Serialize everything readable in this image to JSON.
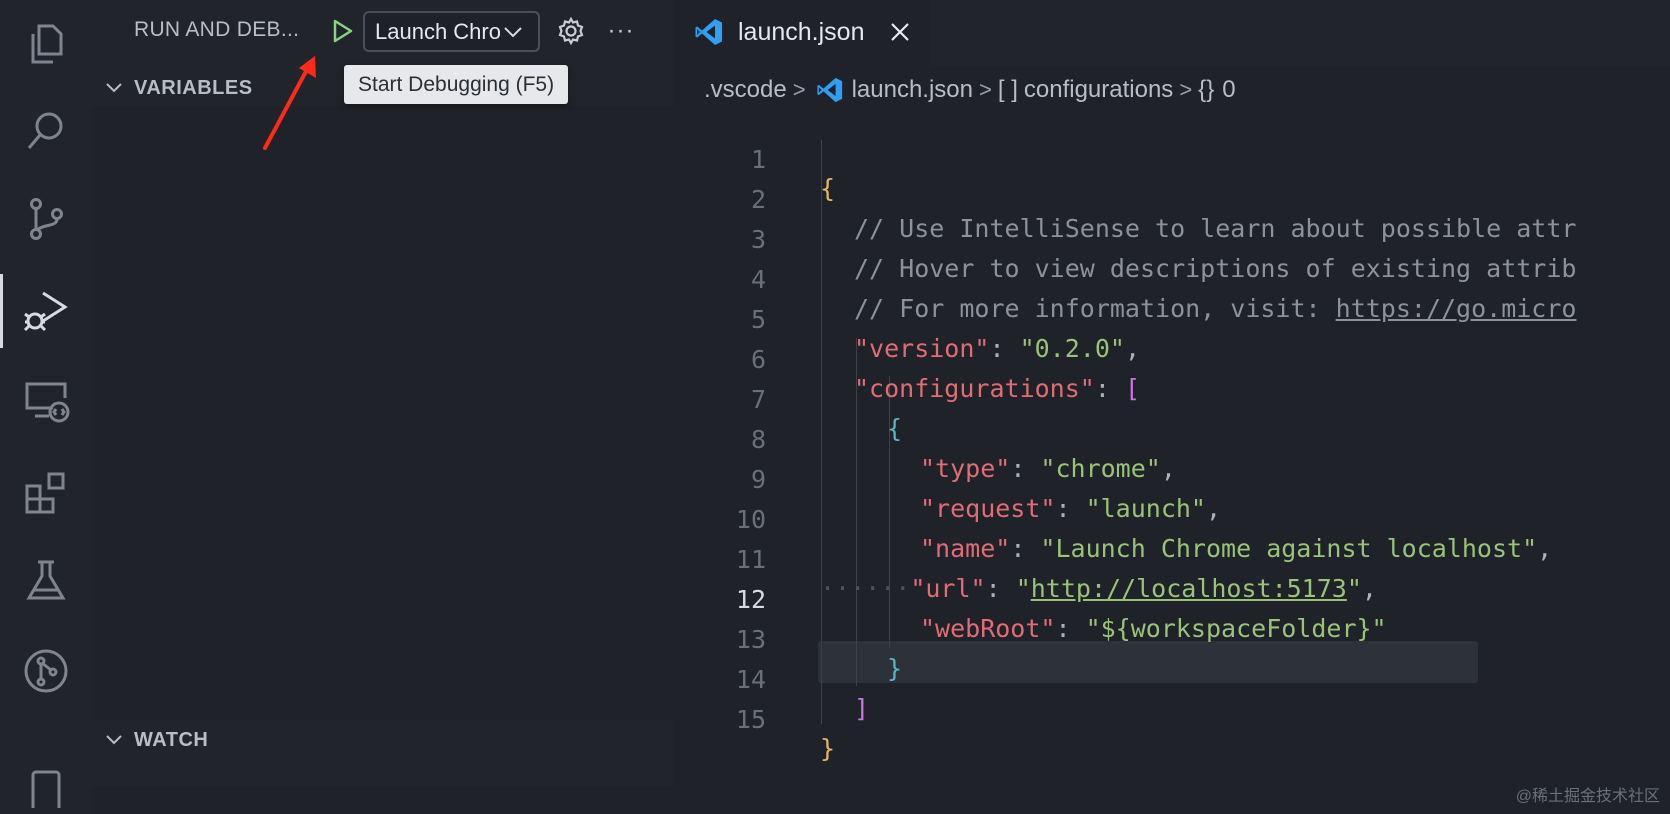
{
  "sidebar": {
    "title": "RUN AND DEB...",
    "config_selected": "Launch Chro",
    "sections": {
      "variables": "VARIABLES",
      "watch": "WATCH"
    }
  },
  "tooltip": "Start Debugging (F5)",
  "editor": {
    "tab_label": "launch.json",
    "breadcrumb": {
      "folder": ".vscode",
      "file": "launch.json",
      "array_prefix": "[ ]",
      "array_label": "configurations",
      "object_prefix": "{}",
      "object_label": "0"
    },
    "current_line": 12,
    "lines": [
      {
        "n": "1",
        "text": "{"
      },
      {
        "n": "2",
        "text": "// Use IntelliSense to learn about possible attr"
      },
      {
        "n": "3",
        "text": "// Hover to view descriptions of existing attrib"
      },
      {
        "n": "4",
        "prefix": "// For more information, visit: ",
        "link": "https://go.micro"
      },
      {
        "n": "5",
        "key": "\"version\"",
        "value": "\"0.2.0\"",
        "end": ","
      },
      {
        "n": "6",
        "key": "\"configurations\"",
        "open": "["
      },
      {
        "n": "7",
        "text": "{"
      },
      {
        "n": "8",
        "key": "\"type\"",
        "value": "\"chrome\"",
        "end": ","
      },
      {
        "n": "9",
        "key": "\"request\"",
        "value": "\"launch\"",
        "end": ","
      },
      {
        "n": "10",
        "key": "\"name\"",
        "value": "\"Launch Chrome against localhost\"",
        "end": ","
      },
      {
        "n": "11",
        "key": "\"url\"",
        "value_link": "http://localhost:5173",
        "end": ","
      },
      {
        "n": "12",
        "key": "\"webRoot\"",
        "value": "\"${workspaceFolder}\""
      },
      {
        "n": "13",
        "text": "}"
      },
      {
        "n": "14",
        "text": "]"
      },
      {
        "n": "15",
        "text": "}"
      }
    ]
  },
  "watermark": "@稀土掘金技术社区",
  "colors": {
    "background": "#1f2228",
    "sidebar": "#21252b",
    "key": "#e06c75",
    "string": "#98c379",
    "comment": "#8b929c",
    "brace": "#e5b567",
    "bracket": "#c678dd",
    "inner_brace": "#56b6c2",
    "play": "#89d185",
    "annotation_arrow": "#ff2a1a",
    "vscode_blue": "#2f9ef4"
  },
  "icons": [
    "explorer-icon",
    "search-icon",
    "source-control-icon",
    "run-debug-icon",
    "remote-explorer-icon",
    "extensions-icon",
    "testing-icon",
    "git-graph-icon",
    "play-icon",
    "gear-icon",
    "ellipsis-icon",
    "chevron-down-icon",
    "vscode-icon",
    "close-icon"
  ]
}
